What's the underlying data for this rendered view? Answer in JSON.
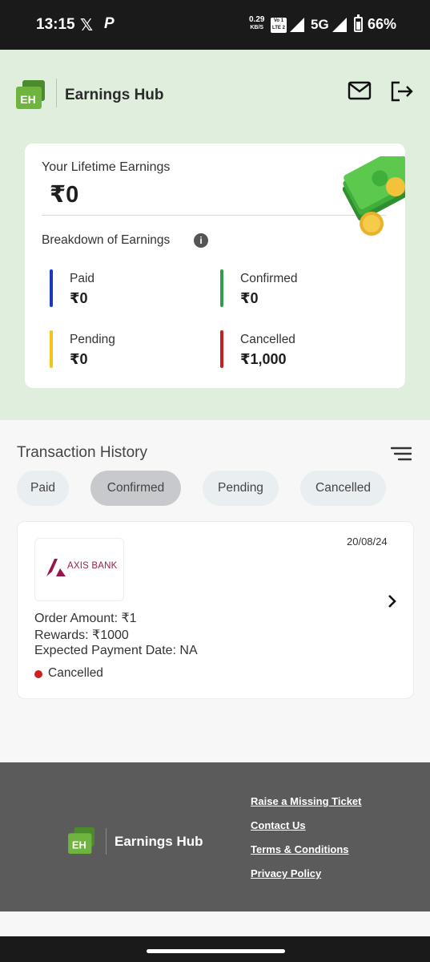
{
  "status_bar": {
    "time": "13:15",
    "x_icon": "x-logo",
    "p_icon": "p-logo",
    "net_speed": "0.29",
    "net_unit": "KB/S",
    "volte": "Vo LTE 2",
    "network": "5G",
    "battery": "66%"
  },
  "header": {
    "logo_text": "EH",
    "brand": "Earnings Hub",
    "mail_icon": "mail-icon",
    "logout_icon": "logout-icon"
  },
  "earnings": {
    "lifetime_label": "Your Lifetime Earnings",
    "lifetime_value": "₹0",
    "breakdown_label": "Breakdown of Earnings",
    "items": [
      {
        "label": "Paid",
        "value": "₹0",
        "color": "#1d39c4"
      },
      {
        "label": "Confirmed",
        "value": "₹0",
        "color": "#2e9e48"
      },
      {
        "label": "Pending",
        "value": "₹0",
        "color": "#f0c419"
      },
      {
        "label": "Cancelled",
        "value": "₹1,000",
        "color": "#c81e1e"
      }
    ]
  },
  "transactions": {
    "title": "Transaction History",
    "filters": [
      "Paid",
      "Confirmed",
      "Pending",
      "Cancelled"
    ],
    "active_filter": "Confirmed",
    "items": [
      {
        "date": "20/08/24",
        "bank": "AXIS BANK",
        "order_amount": "Order Amount: ₹1",
        "rewards": "Rewards: ₹1000",
        "expected_date": "Expected Payment Date: NA",
        "status": "Cancelled",
        "status_color": "#d12020"
      }
    ]
  },
  "footer": {
    "logo_text": "EH",
    "brand": "Earnings Hub",
    "links": [
      "Raise a Missing Ticket",
      "Contact Us",
      "Terms & Conditions",
      "Privacy Policy"
    ]
  }
}
